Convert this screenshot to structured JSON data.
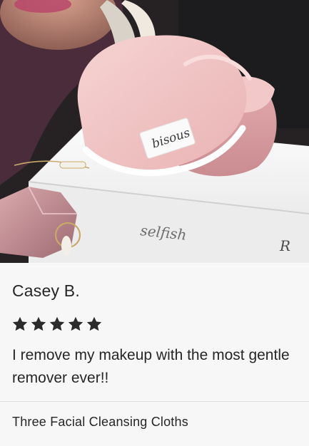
{
  "photo": {
    "alt_icon": "product-photo",
    "tag_text": "bisous",
    "book_text": "selfish",
    "book_mark": "R"
  },
  "review": {
    "reviewer_name": "Casey B.",
    "rating": 5,
    "rating_max": 5,
    "text": "I remove my makeup with the most gentle remover ever!!",
    "product_name": "Three Facial Cleansing Cloths"
  },
  "colors": {
    "star": "#2b2b2b",
    "background": "#f7f7f7",
    "text": "#262626"
  }
}
